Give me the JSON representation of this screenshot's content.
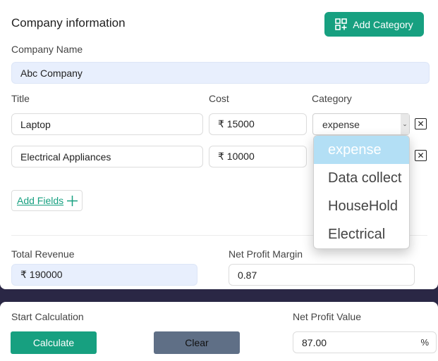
{
  "company": {
    "title": "Company information",
    "add_category_label": "Add Category",
    "name_label": "Company Name",
    "name_value": "Abc Company"
  },
  "columns": {
    "title": "Title",
    "cost": "Cost",
    "category": "Category"
  },
  "rows": [
    {
      "title": "Laptop",
      "cost": "₹ 15000",
      "category": "expense"
    },
    {
      "title": "Electrical Appliances",
      "cost": "₹ 10000",
      "category": ""
    }
  ],
  "close_symbol": "✕",
  "add_fields_label": "Add Fields",
  "dropdown": {
    "options": [
      "expense",
      "Data collect",
      "HouseHold",
      "Electrical"
    ],
    "selected_index": 0
  },
  "revenue": {
    "label": "Total Revenue",
    "value": "₹ 190000"
  },
  "margin": {
    "label": "Net Profit Margin",
    "value": "0.87"
  },
  "calc": {
    "start_label": "Start Calculation",
    "calculate_label": "Calculate",
    "clear_label": "Clear",
    "profit_label": "Net Profit Value",
    "profit_value": "87.00",
    "profit_unit": "%"
  },
  "colors": {
    "accent": "#17a080",
    "clear_button": "#5f6f86",
    "page_background": "#2a2745",
    "highlight_option": "#b3dff5"
  }
}
